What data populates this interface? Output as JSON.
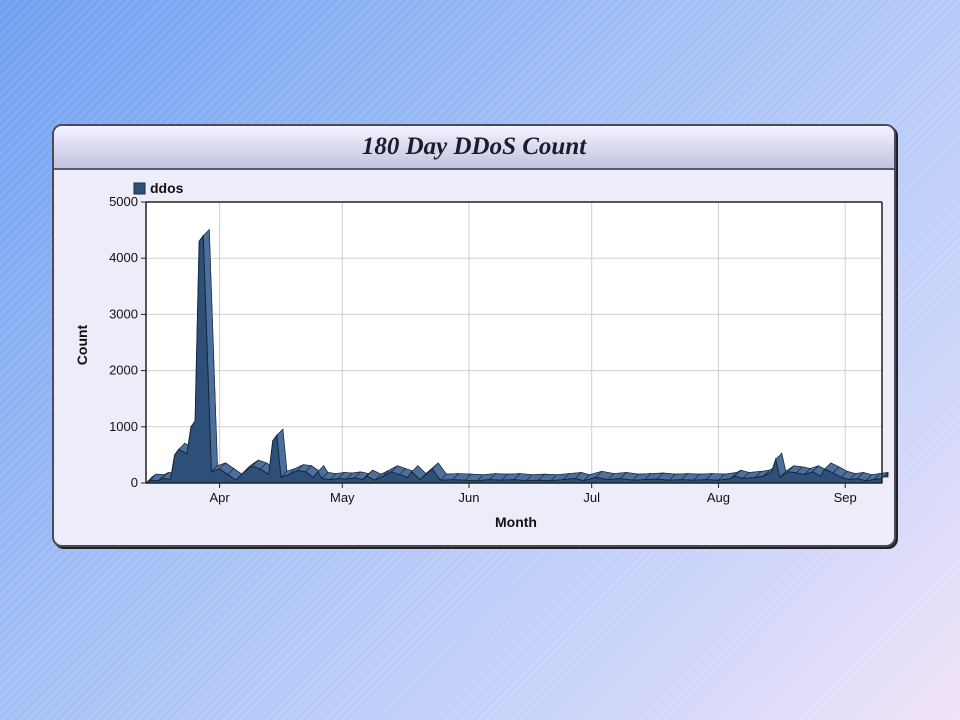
{
  "chart_data": {
    "type": "area",
    "title": "180 Day DDoS Count",
    "xlabel": "Month",
    "ylabel": "Count",
    "ylim": [
      0,
      5000
    ],
    "yticks": [
      0,
      1000,
      2000,
      3000,
      4000,
      5000
    ],
    "x_date_range": [
      "2012-03-14",
      "2012-09-10"
    ],
    "xticks": [
      {
        "label": "Apr",
        "date": "2012-04-01"
      },
      {
        "label": "May",
        "date": "2012-05-01"
      },
      {
        "label": "Jun",
        "date": "2012-06-01"
      },
      {
        "label": "Jul",
        "date": "2012-07-01"
      },
      {
        "label": "Aug",
        "date": "2012-08-01"
      },
      {
        "label": "Sep",
        "date": "2012-09-01"
      }
    ],
    "grid": true,
    "legend": "top-left",
    "series": [
      {
        "name": "ddos",
        "color": "#2e4f78",
        "points": [
          [
            "2012-03-14",
            0
          ],
          [
            "2012-03-15",
            50
          ],
          [
            "2012-03-17",
            40
          ],
          [
            "2012-03-18",
            80
          ],
          [
            "2012-03-20",
            70
          ],
          [
            "2012-03-21",
            500
          ],
          [
            "2012-03-22",
            600
          ],
          [
            "2012-03-24",
            520
          ],
          [
            "2012-03-25",
            1000
          ],
          [
            "2012-03-26",
            1100
          ],
          [
            "2012-03-27",
            4300
          ],
          [
            "2012-03-28",
            4400
          ],
          [
            "2012-03-30",
            200
          ],
          [
            "2012-04-01",
            250
          ],
          [
            "2012-04-03",
            150
          ],
          [
            "2012-04-05",
            50
          ],
          [
            "2012-04-07",
            200
          ],
          [
            "2012-04-09",
            300
          ],
          [
            "2012-04-11",
            250
          ],
          [
            "2012-04-13",
            150
          ],
          [
            "2012-04-14",
            750
          ],
          [
            "2012-04-15",
            850
          ],
          [
            "2012-04-16",
            100
          ],
          [
            "2012-04-18",
            150
          ],
          [
            "2012-04-20",
            220
          ],
          [
            "2012-04-22",
            200
          ],
          [
            "2012-04-24",
            100
          ],
          [
            "2012-04-25",
            200
          ],
          [
            "2012-04-26",
            80
          ],
          [
            "2012-04-28",
            60
          ],
          [
            "2012-04-30",
            80
          ],
          [
            "2012-05-02",
            70
          ],
          [
            "2012-05-04",
            90
          ],
          [
            "2012-05-06",
            60
          ],
          [
            "2012-05-07",
            120
          ],
          [
            "2012-05-09",
            50
          ],
          [
            "2012-05-11",
            120
          ],
          [
            "2012-05-13",
            200
          ],
          [
            "2012-05-15",
            150
          ],
          [
            "2012-05-17",
            100
          ],
          [
            "2012-05-18",
            200
          ],
          [
            "2012-05-20",
            60
          ],
          [
            "2012-05-23",
            250
          ],
          [
            "2012-05-25",
            50
          ],
          [
            "2012-05-28",
            60
          ],
          [
            "2012-05-31",
            50
          ],
          [
            "2012-06-03",
            40
          ],
          [
            "2012-06-06",
            60
          ],
          [
            "2012-06-09",
            50
          ],
          [
            "2012-06-12",
            60
          ],
          [
            "2012-06-15",
            40
          ],
          [
            "2012-06-18",
            50
          ],
          [
            "2012-06-21",
            40
          ],
          [
            "2012-06-24",
            60
          ],
          [
            "2012-06-27",
            80
          ],
          [
            "2012-06-29",
            40
          ],
          [
            "2012-07-02",
            100
          ],
          [
            "2012-07-05",
            60
          ],
          [
            "2012-07-08",
            80
          ],
          [
            "2012-07-11",
            50
          ],
          [
            "2012-07-14",
            60
          ],
          [
            "2012-07-17",
            70
          ],
          [
            "2012-07-20",
            50
          ],
          [
            "2012-07-23",
            60
          ],
          [
            "2012-07-26",
            50
          ],
          [
            "2012-07-29",
            60
          ],
          [
            "2012-08-01",
            50
          ],
          [
            "2012-08-04",
            80
          ],
          [
            "2012-08-05",
            120
          ],
          [
            "2012-08-07",
            80
          ],
          [
            "2012-08-10",
            100
          ],
          [
            "2012-08-12",
            120
          ],
          [
            "2012-08-14",
            200
          ],
          [
            "2012-08-15",
            420
          ],
          [
            "2012-08-16",
            100
          ],
          [
            "2012-08-18",
            200
          ],
          [
            "2012-08-20",
            180
          ],
          [
            "2012-08-22",
            150
          ],
          [
            "2012-08-24",
            200
          ],
          [
            "2012-08-26",
            120
          ],
          [
            "2012-08-27",
            250
          ],
          [
            "2012-08-29",
            180
          ],
          [
            "2012-08-31",
            100
          ],
          [
            "2012-09-02",
            60
          ],
          [
            "2012-09-04",
            80
          ],
          [
            "2012-09-06",
            40
          ],
          [
            "2012-09-08",
            60
          ],
          [
            "2012-09-10",
            80
          ]
        ]
      }
    ]
  }
}
